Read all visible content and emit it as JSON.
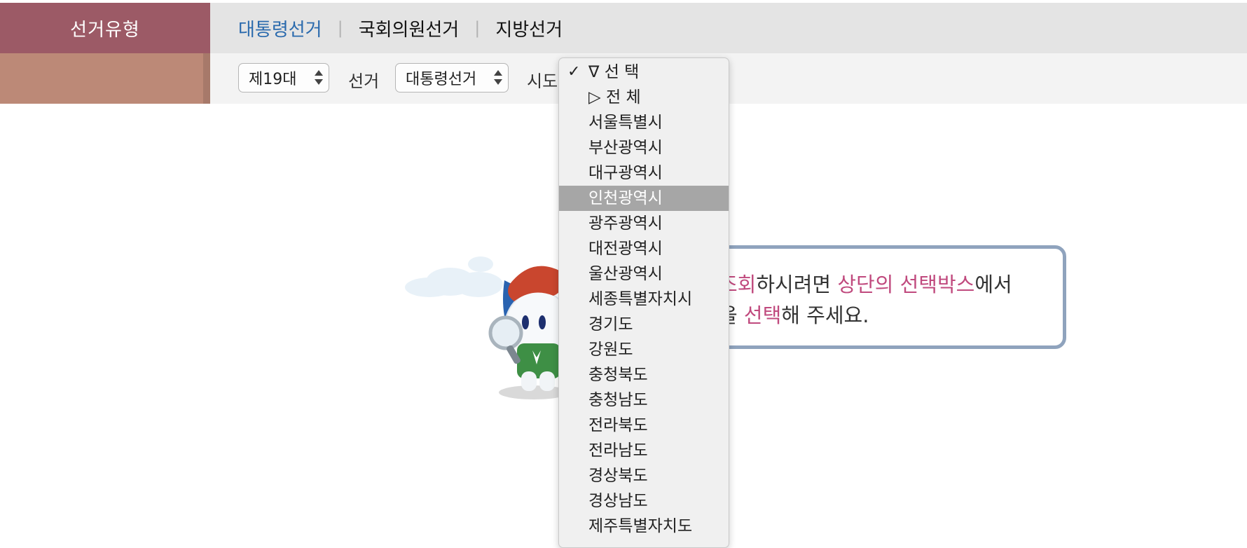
{
  "header": {
    "type_label": "선거유형",
    "tabs": [
      {
        "label": "대통령선거",
        "active": true
      },
      {
        "label": "국회의원선거",
        "active": false
      },
      {
        "label": "지방선거",
        "active": false
      }
    ],
    "separator": "|"
  },
  "filters": {
    "term": {
      "value": "제19대"
    },
    "election_label": "선거",
    "election": {
      "value": "대통령선거"
    },
    "region_label": "시도"
  },
  "region_dropdown": {
    "checkmark": "✓",
    "selected_index": 0,
    "hover_index": 5,
    "options": [
      "∇ 선 택",
      "▷ 전 체",
      "서울특별시",
      "부산광역시",
      "대구광역시",
      "인천광역시",
      "광주광역시",
      "대전광역시",
      "울산광역시",
      "세종특별자치시",
      "경기도",
      "강원도",
      "충청북도",
      "충청남도",
      "전라북도",
      "전라남도",
      "경상북도",
      "경상남도",
      "제주특별자치도"
    ]
  },
  "message": {
    "line1": [
      {
        "text": "조회",
        "highlight": true
      },
      {
        "text": "하시려면 ",
        "highlight": false
      },
      {
        "text": "상단의 선택박스",
        "highlight": true
      },
      {
        "text": "에서",
        "highlight": false
      }
    ],
    "line2": [
      {
        "text": "을 ",
        "highlight": false
      },
      {
        "text": "선택",
        "highlight": true
      },
      {
        "text": "해 주세요.",
        "highlight": false
      }
    ]
  },
  "colors": {
    "type_label_bg": "#9c5a66",
    "active_tab": "#2a6aad",
    "highlight": "#c04a7e",
    "message_border": "#8fa3bd",
    "hover_bg": "#a6a6a6"
  }
}
